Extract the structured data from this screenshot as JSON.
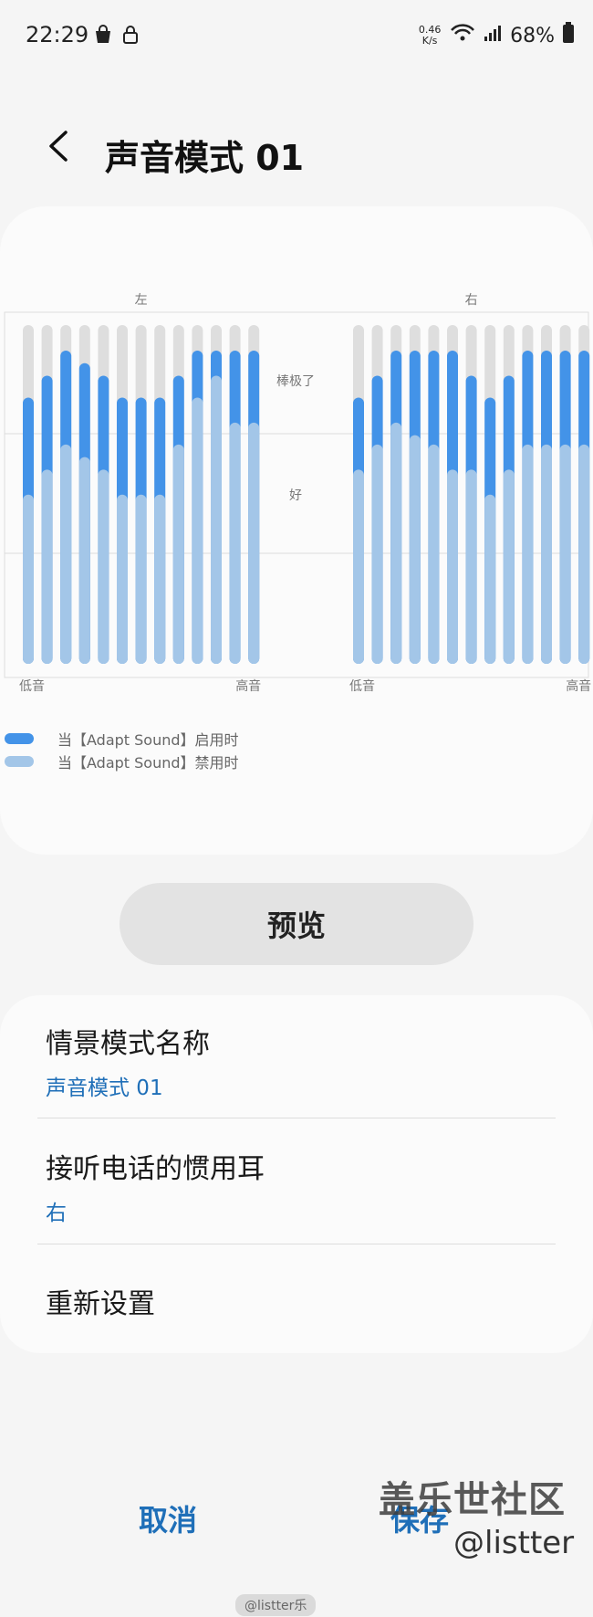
{
  "status_bar": {
    "time": "22:29",
    "net_speed_value": "0.46",
    "net_speed_unit": "K/s",
    "battery": "68%",
    "icons": [
      "shopping-bag-icon",
      "lock-icon",
      "wifi-icon",
      "signal-icon",
      "battery-icon"
    ]
  },
  "app_bar": {
    "title": "声音模式 01",
    "back_icon": "back-chevron-icon"
  },
  "chart_data": {
    "type": "bar",
    "panels": [
      {
        "label": "左",
        "low_label": "低音",
        "high_label": "高音",
        "enabled_values": [
          0.85,
          0.92,
          1.0,
          0.96,
          0.92,
          0.85,
          0.85,
          0.85,
          0.92,
          1.0,
          1.0,
          1.0,
          1.0
        ],
        "disabled_values": [
          0.54,
          0.62,
          0.7,
          0.66,
          0.62,
          0.54,
          0.54,
          0.54,
          0.7,
          0.85,
          0.92,
          0.77,
          0.77
        ]
      },
      {
        "label": "右",
        "low_label": "低音",
        "high_label": "高音",
        "enabled_values": [
          0.85,
          0.92,
          1.0,
          1.0,
          1.0,
          1.0,
          0.92,
          0.85,
          0.92,
          1.0,
          1.0,
          1.0,
          1.0
        ],
        "disabled_values": [
          0.62,
          0.7,
          0.77,
          0.73,
          0.7,
          0.62,
          0.62,
          0.54,
          0.62,
          0.7,
          0.7,
          0.7,
          0.7
        ]
      }
    ],
    "levels": [
      {
        "label": "棒极了"
      },
      {
        "label": "好"
      }
    ],
    "series": [
      {
        "name": "当【Adapt Sound】启用时",
        "color": "#4393e8"
      },
      {
        "name": "当【Adapt Sound】禁用时",
        "color": "#a3c6e8"
      }
    ],
    "track_color": "#dedede"
  },
  "preview_button": {
    "label": "预览"
  },
  "settings": {
    "scenario_name_title": "情景模式名称",
    "scenario_name_value": "声音模式 01",
    "call_ear_title": "接听电话的惯用耳",
    "call_ear_value": "右",
    "reset_title": "重新设置"
  },
  "bottom": {
    "cancel_label": "取消",
    "save_label": "保存"
  },
  "watermarks": {
    "community": "盖乐世社区",
    "handle": "@listter",
    "weibo": "@listter乐"
  },
  "colors": {
    "accent": "#1f6fb8"
  }
}
